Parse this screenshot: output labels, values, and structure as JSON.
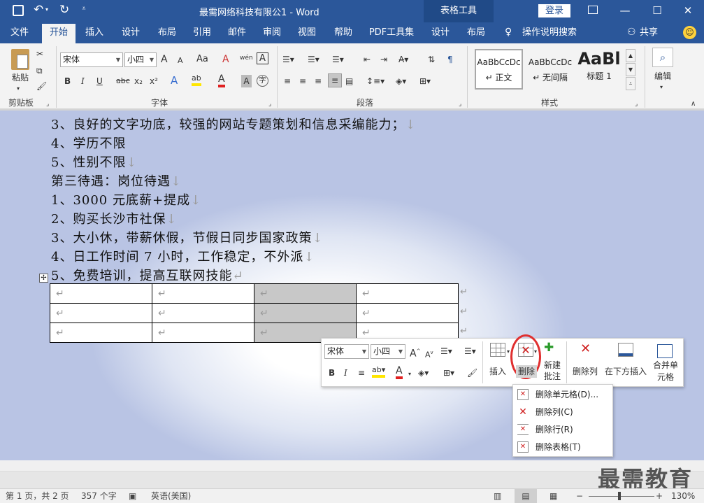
{
  "window": {
    "title": "最需网络科技有限公1 - Word",
    "context_tab": "表格工具",
    "login": "登录",
    "qat": {
      "save_icon": "save-icon",
      "undo_icon": "undo-icon",
      "redo_icon": "redo-icon",
      "customize_icon": "qat-dropdown-icon"
    }
  },
  "tabs": [
    "文件",
    "开始",
    "插入",
    "设计",
    "布局",
    "引用",
    "邮件",
    "审阅",
    "视图",
    "帮助",
    "PDF工具集",
    "设计",
    "布局"
  ],
  "active_tab": "开始",
  "tell_me": "操作说明搜索",
  "share": "共享",
  "ribbon": {
    "clipboard": {
      "paste": "粘贴",
      "label": "剪贴板"
    },
    "font": {
      "name": "宋体",
      "size": "小四",
      "label": "字体",
      "grow": "A",
      "shrink": "A",
      "case": "Aa",
      "clear": "A",
      "wen": "wén",
      "char_border": "A",
      "bold": "B",
      "italic": "I",
      "underline": "U",
      "strike": "abc",
      "sub": "x₂",
      "sup": "x²",
      "effects": "A",
      "highlight": "ab",
      "color": "A",
      "shade": "A",
      "circle": "字"
    },
    "paragraph": {
      "label": "段落"
    },
    "styles": {
      "label": "样式",
      "items": [
        {
          "preview": "AaBbCcDc",
          "name": "↵ 正文"
        },
        {
          "preview": "AaBbCcDc",
          "name": "↵ 无间隔"
        },
        {
          "preview": "AaBl",
          "name": "标题 1"
        }
      ]
    },
    "editing": {
      "label": "编辑"
    }
  },
  "document": {
    "lines": [
      {
        "text": "3、良好的文字功底，较强的网站专题策划和信息采编能力；",
        "mark": "↓"
      },
      {
        "text": "4、学历不限",
        "mark": ""
      },
      {
        "text": "5、性别不限",
        "mark": "↓"
      },
      {
        "text": "第三待遇：岗位待遇",
        "mark": "↓"
      },
      {
        "text": "1、3000 元底薪+提成",
        "mark": "↓"
      },
      {
        "text": "2、购买长沙市社保",
        "mark": "↓"
      },
      {
        "text": "3、大小休，带薪休假，节假日同步国家政策",
        "mark": "↓"
      },
      {
        "text": "4、日工作时间 7 小时，工作稳定，不外派",
        "mark": "↓"
      },
      {
        "text": "5、免费培训，提高互联网技能",
        "mark": "↵"
      }
    ],
    "cell_mark": "↵",
    "row_end_mark": "↵"
  },
  "minibar": {
    "font": "宋体",
    "size": "小四",
    "insert": "插入",
    "delete": "删除",
    "new_comment_1": "新建",
    "new_comment_2": "批注",
    "delete_col": "删除列",
    "insert_below": "在下方插入",
    "merge_1": "合并单",
    "merge_2": "元格"
  },
  "delete_menu": [
    "删除单元格(D)...",
    "删除列(C)",
    "删除行(R)",
    "删除表格(T)"
  ],
  "status": {
    "page": "第 1 页，共 2 页",
    "words": "357 个字",
    "lang": "英语(美国)",
    "zoom": "130%"
  },
  "watermark": "最需教育",
  "colors": {
    "brand": "#2b579a",
    "highlight_circle": "#e03030",
    "font_red": "#e02020",
    "highlight_yellow": "#ffe600"
  }
}
